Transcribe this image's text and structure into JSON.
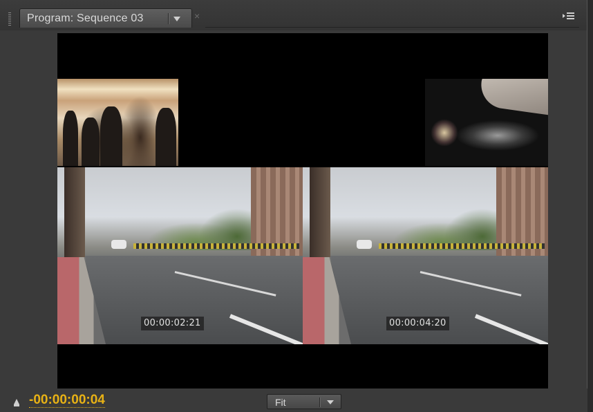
{
  "panel": {
    "tab_title": "Program: Sequence 03",
    "tab_menu_icon": "chevron-down-icon",
    "close_icon": "close-icon",
    "panel_menu_icon": "panel-menu-icon"
  },
  "monitor": {
    "clips": [
      {
        "id": "lobby",
        "type": "picture-in-picture"
      },
      {
        "id": "dj",
        "type": "picture-in-picture"
      },
      {
        "id": "street-left",
        "timecode": "00:00:02:21"
      },
      {
        "id": "street-right",
        "timecode": "00:00:04:20"
      }
    ]
  },
  "footer": {
    "playhead_icon": "playhead-icon",
    "timecode": "-00:00:00:04",
    "zoom_value": "Fit"
  },
  "colors": {
    "timecode": "#e8b215",
    "panel_bg": "#3a3a3a",
    "monitor_bg": "#000000"
  }
}
